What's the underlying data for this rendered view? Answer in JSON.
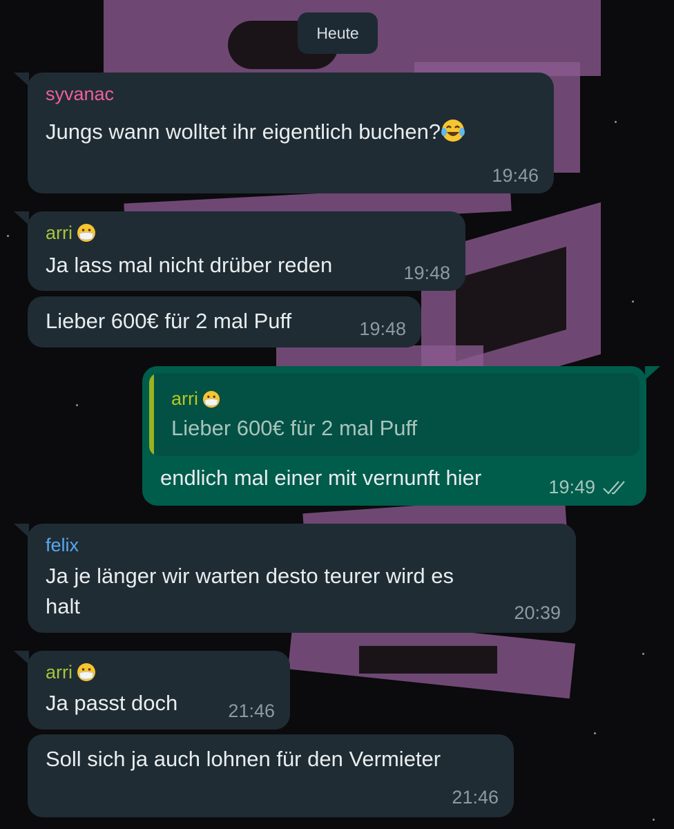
{
  "date_divider": "Heute",
  "messages": [
    {
      "sender": "syvanac",
      "sender_color": "#f0609a",
      "text": "Jungs wann wolltet ihr eigentlich buchen?",
      "emoji": "tears-of-joy-emoji",
      "time": "19:46"
    },
    {
      "sender": "arri",
      "sender_color": "#a7c43a",
      "sender_emoji": "face-with-medical-mask-emoji",
      "text": "Ja lass mal nicht drüber reden",
      "time": "19:48"
    },
    {
      "text": "Lieber 600€ für 2 mal Puff",
      "time": "19:48"
    },
    {
      "outgoing": true,
      "quote": {
        "sender": "arri",
        "text": "Lieber 600€ für 2 mal Puff"
      },
      "text": "endlich mal einer mit vernunft hier",
      "time": "19:49",
      "status": "double-check-icon"
    },
    {
      "sender": "felix",
      "sender_color": "#58a8ee",
      "text_line1": "Ja je länger wir warten desto teurer wird es",
      "text_line2": "halt",
      "time": "20:39"
    },
    {
      "sender": "arri",
      "sender_color": "#a7c43a",
      "sender_emoji": "face-with-medical-mask-emoji",
      "text": "Ja passt doch",
      "time": "21:46"
    },
    {
      "text": "Soll sich ja auch lohnen für den Vermieter",
      "time": "21:46"
    }
  ],
  "colors": {
    "incoming_bubble": "#1f2c34",
    "outgoing_bubble": "#005c4b",
    "quote_accent": "#9ab31f"
  }
}
